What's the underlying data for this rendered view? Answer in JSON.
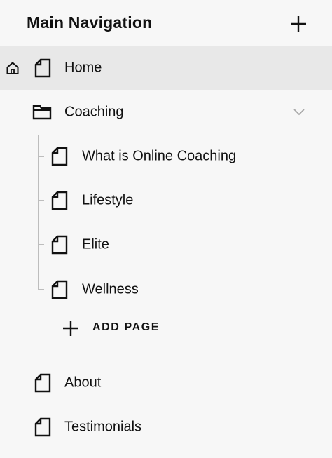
{
  "header": {
    "title": "Main Navigation"
  },
  "nav": {
    "home": {
      "label": "Home"
    },
    "coaching": {
      "label": "Coaching",
      "children": [
        {
          "label": "What is Online Coaching"
        },
        {
          "label": "Lifestyle"
        },
        {
          "label": "Elite"
        },
        {
          "label": "Wellness"
        }
      ],
      "add_page_label": "ADD PAGE"
    },
    "about": {
      "label": "About"
    },
    "testimonials": {
      "label": "Testimonials"
    }
  },
  "icons": {
    "add": "plus-icon",
    "home": "home-icon",
    "page": "page-icon",
    "folder": "folder-icon",
    "expand": "chevron-down-icon"
  }
}
